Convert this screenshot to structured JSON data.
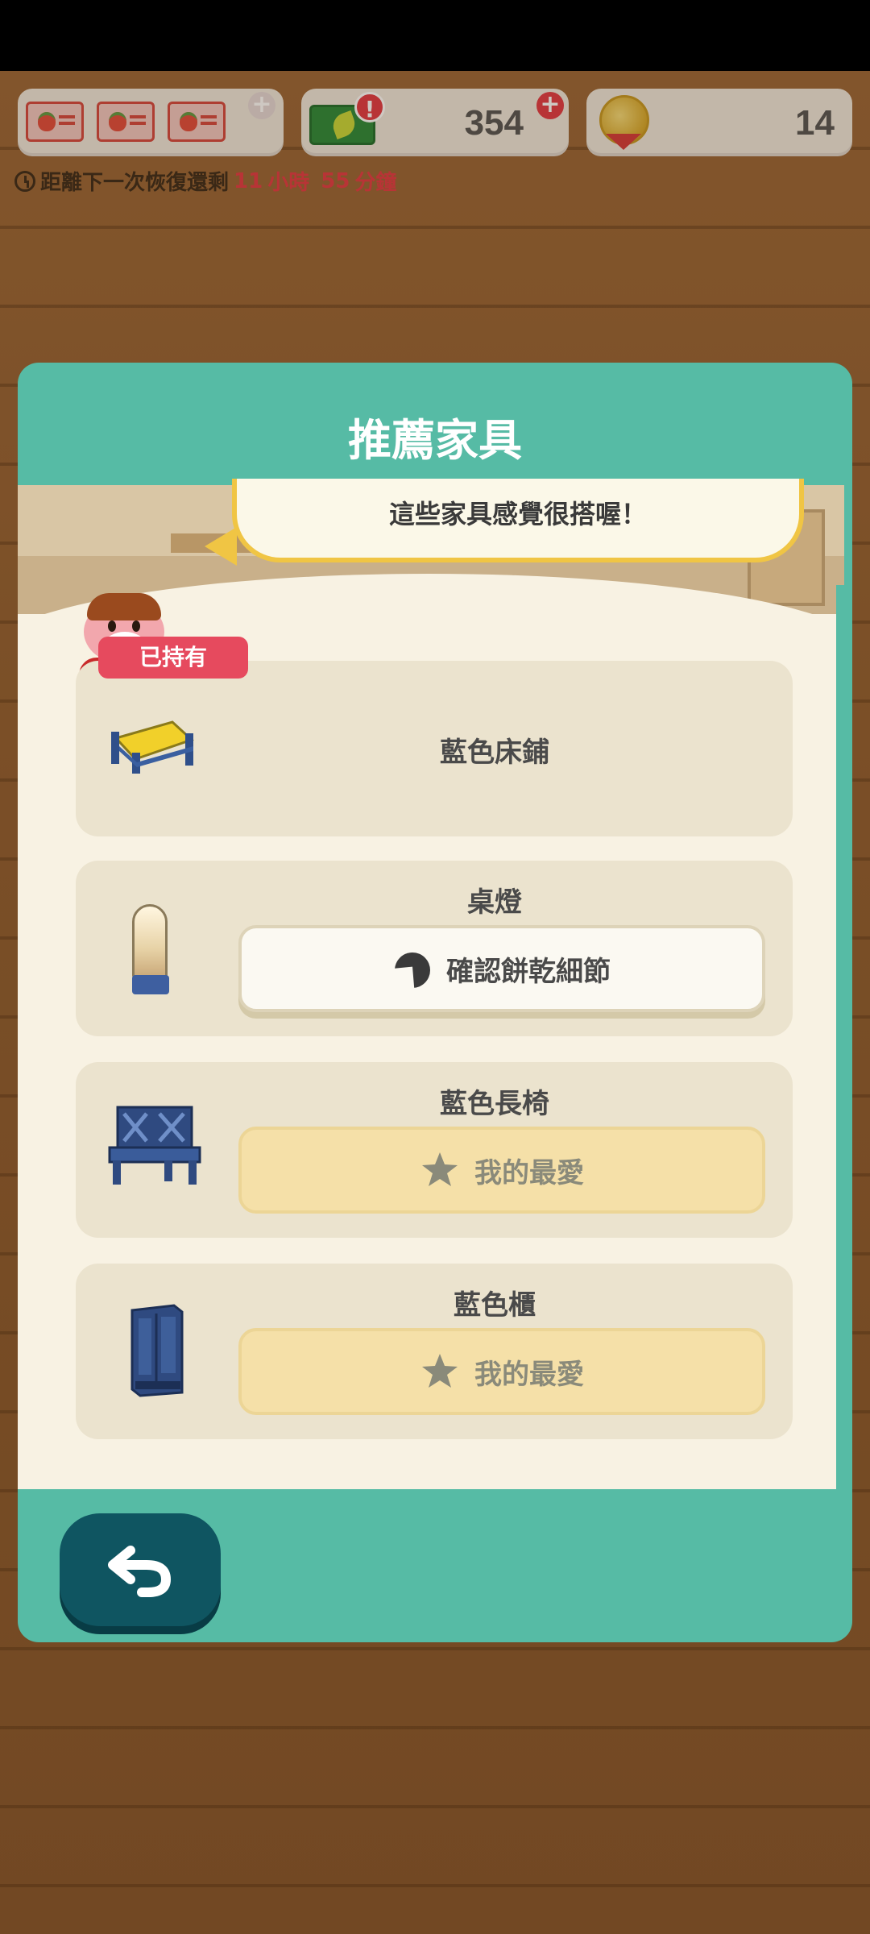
{
  "resources": {
    "leaf_tickets": "354",
    "bells_medals": "14"
  },
  "timer": {
    "prefix": "距離下一次恢復還剩",
    "hours_value": "11",
    "hours_unit": "小時",
    "minutes_value": "55",
    "minutes_unit": "分鐘"
  },
  "dialog": {
    "title": "推薦家具",
    "speech": "這些家具感覺很搭喔！"
  },
  "items": [
    {
      "name": "藍色床鋪",
      "badge": "已持有",
      "icon": "blue-bed-icon"
    },
    {
      "name": "桌燈",
      "button_label": "確認餅乾細節",
      "button_icon": "fortune-cookie-icon",
      "icon": "table-lamp-icon"
    },
    {
      "name": "藍色長椅",
      "button_label": "我的最愛",
      "button_icon": "star-icon",
      "icon": "blue-bench-icon"
    },
    {
      "name": "藍色櫃",
      "button_label": "我的最愛",
      "button_icon": "star-icon",
      "icon": "blue-wardrobe-icon"
    }
  ],
  "colors": {
    "dialog_teal": "#56bba5",
    "badge_red": "#e64a5e",
    "back_button": "#0f5561"
  }
}
